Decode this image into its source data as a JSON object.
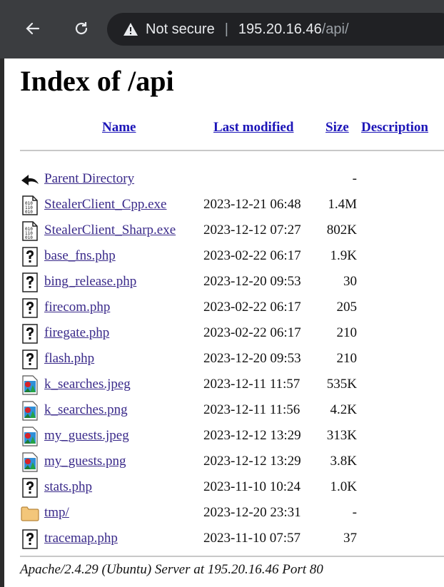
{
  "browser": {
    "security_label": "Not secure",
    "url_host": "195.20.16.46",
    "url_path": "/api/"
  },
  "page": {
    "title": "Index of /api",
    "columns": {
      "name": "Name",
      "last_modified": "Last modified",
      "size": "Size",
      "description": "Description"
    },
    "rows": [
      {
        "name": "Parent Directory",
        "date": "",
        "size": "-",
        "icon": "back-arrow-icon"
      },
      {
        "name": "StealerClient_Cpp.exe",
        "date": "2023-12-21 06:48",
        "size": "1.4M",
        "icon": "binary-file-icon"
      },
      {
        "name": "StealerClient_Sharp.exe",
        "date": "2023-12-12 07:27",
        "size": "802K",
        "icon": "binary-file-icon"
      },
      {
        "name": "base_fns.php",
        "date": "2023-02-22 06:17",
        "size": "1.9K",
        "icon": "unknown-file-icon"
      },
      {
        "name": "bing_release.php",
        "date": "2023-12-20 09:53",
        "size": "30",
        "icon": "unknown-file-icon"
      },
      {
        "name": "firecom.php",
        "date": "2023-02-22 06:17",
        "size": "205",
        "icon": "unknown-file-icon"
      },
      {
        "name": "firegate.php",
        "date": "2023-02-22 06:17",
        "size": "210",
        "icon": "unknown-file-icon"
      },
      {
        "name": "flash.php",
        "date": "2023-12-20 09:53",
        "size": "210",
        "icon": "unknown-file-icon"
      },
      {
        "name": "k_searches.jpeg",
        "date": "2023-12-11 11:57",
        "size": "535K",
        "icon": "image-file-icon"
      },
      {
        "name": "k_searches.png",
        "date": "2023-12-11 11:56",
        "size": "4.2K",
        "icon": "image-file-icon"
      },
      {
        "name": "my_guests.jpeg",
        "date": "2023-12-12 13:29",
        "size": "313K",
        "icon": "image-file-icon"
      },
      {
        "name": "my_guests.png",
        "date": "2023-12-12 13:29",
        "size": "3.8K",
        "icon": "image-file-icon"
      },
      {
        "name": "stats.php",
        "date": "2023-11-10 10:24",
        "size": "1.0K",
        "icon": "unknown-file-icon"
      },
      {
        "name": "tmp/",
        "date": "2023-12-20 23:31",
        "size": "-",
        "icon": "folder-icon"
      },
      {
        "name": "tracemap.php",
        "date": "2023-11-10 07:57",
        "size": "37",
        "icon": "unknown-file-icon"
      }
    ],
    "server_signature": "Apache/2.4.29 (Ubuntu) Server at 195.20.16.46 Port 80"
  }
}
